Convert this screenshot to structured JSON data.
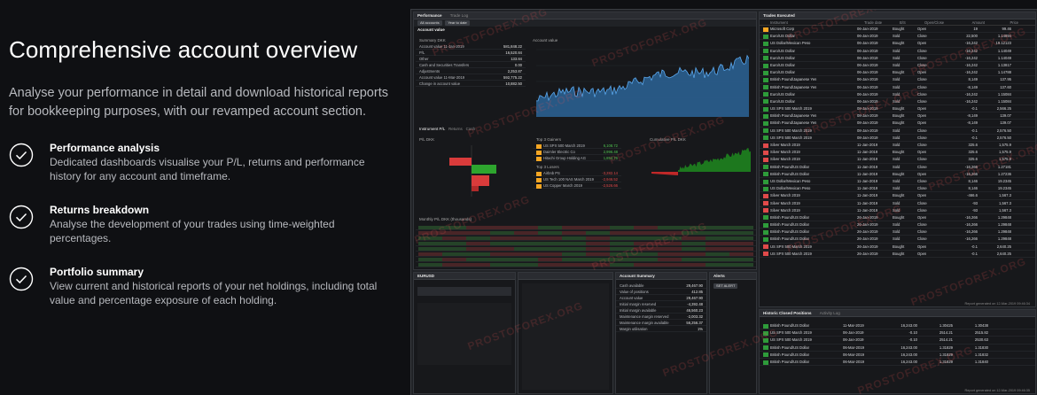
{
  "hero": {
    "headline": "Comprehensive account overview",
    "intro": "Analyse your performance in detail and download historical reports for bookkeeping purposes, with our revamped account section."
  },
  "features": [
    {
      "title": "Performance analysis",
      "desc": "Dedicated dashboards visualise your P/L, returns and performance history for any account and timeframe."
    },
    {
      "title": "Returns breakdown",
      "desc": "Analyse the development of your trades using time-weighted percentages."
    },
    {
      "title": "Portfolio summary",
      "desc": "View current and historical reports of your net holdings, including total value and percentage exposure of each holding."
    }
  ],
  "watermark": "PROSTOFOREX.ORG",
  "colors": {
    "background": "#0f1013",
    "positive": "#4fc24f",
    "negative": "#e04a4a",
    "chart_blue": "#3d8fd6",
    "accent_orange": "#f5a623"
  },
  "screenshot": {
    "performance": {
      "tabs": [
        "Performance",
        "Trade Log"
      ],
      "filter_account": "All accounts",
      "filter_period": "Year to date",
      "section_title": "Account value",
      "summary_title": "Summary DKK",
      "chart_title": "Account value",
      "summary_rows": [
        {
          "label": "Account value 11-Jan-2019",
          "value": "581,848.22"
        },
        {
          "label": "P/L",
          "value": "16,520.84"
        },
        {
          "label": "Other",
          "value": "133.84"
        },
        {
          "label": "Cash and Securities Transfers",
          "value": "0.00"
        },
        {
          "label": "Adjustments",
          "value": "2,253.87"
        },
        {
          "label": "Account value 11-Mar-2019",
          "value": "592,775.22"
        },
        {
          "label": "Change in account value",
          "value": "10,882.50"
        }
      ],
      "instrument_tabs": [
        "Instrument P/L",
        "Returns",
        "Cash"
      ],
      "top_gainers_title": "Top 3 Gainers",
      "top_gainers": [
        {
          "name": "US SPX 500 March 2019",
          "value": "6,108.72"
        },
        {
          "name": "Daimler Electric Co",
          "value": "2,996.48"
        },
        {
          "name": "Hitachi Group Holding AG",
          "value": "1,854.76"
        }
      ],
      "top_losers_title": "Top 3 Losers",
      "top_losers": [
        {
          "name": "Airbnb PS",
          "value": "-3,282.14"
        },
        {
          "name": "US Tech 100 NAS March 2019",
          "value": "-2,946.52"
        },
        {
          "name": "US Copper March 2019",
          "value": "-2,526.66"
        }
      ],
      "cum_title": "Cumulative P/L DKK",
      "monthly_title": "Monthly P/L DKK (thousands)",
      "pl_title": "P/L DKK"
    },
    "trades": {
      "title": "Trades Executed",
      "columns": [
        "Instrument",
        "Trade date",
        "B/S",
        "Open/Close",
        "Amount",
        "Price"
      ],
      "rows": [
        {
          "badge": "orange",
          "name": "Microsoft Corp",
          "date": "06-Jan-2019",
          "bs": "Bought",
          "oc": "Open",
          "amount": "19",
          "price": "99.46"
        },
        {
          "badge": "green",
          "name": "Euro/US Dollar",
          "date": "06-Jan-2019",
          "bs": "Sold",
          "oc": "Close",
          "amount": "22,500",
          "price": "1.14894"
        },
        {
          "badge": "green",
          "name": "US Dollar/Mexican Peso",
          "date": "06-Jan-2019",
          "bs": "Bought",
          "oc": "Open",
          "amount": "-16,242",
          "price": "19.12123"
        },
        {
          "badge": "green",
          "name": "Euro/US Dollar",
          "date": "06-Jan-2019",
          "bs": "Sold",
          "oc": "Close",
          "amount": "-16,242",
          "price": "1.14049"
        },
        {
          "badge": "green",
          "name": "Euro/US Dollar",
          "date": "06-Jan-2019",
          "bs": "Sold",
          "oc": "Close",
          "amount": "-16,242",
          "price": "1.14049"
        },
        {
          "badge": "green",
          "name": "Euro/US Dollar",
          "date": "06-Jan-2019",
          "bs": "Sold",
          "oc": "Close",
          "amount": "-16,242",
          "price": "1.13817"
        },
        {
          "badge": "green",
          "name": "Euro/US Dollar",
          "date": "06-Jan-2019",
          "bs": "Bought",
          "oc": "Open",
          "amount": "-16,242",
          "price": "1.14788"
        },
        {
          "badge": "green",
          "name": "British Pound/Japanese Yen",
          "date": "06-Jan-2019",
          "bs": "Sold",
          "oc": "Close",
          "amount": "8,149",
          "price": "137.95"
        },
        {
          "badge": "green",
          "name": "British Pound/Japanese Yen",
          "date": "06-Jan-2019",
          "bs": "Sold",
          "oc": "Close",
          "amount": "-8,149",
          "price": "137.60"
        },
        {
          "badge": "green",
          "name": "Euro/US Dollar",
          "date": "06-Jan-2019",
          "bs": "Sold",
          "oc": "Close",
          "amount": "-16,242",
          "price": "1.15084"
        },
        {
          "badge": "green",
          "name": "Euro/US Dollar",
          "date": "06-Jan-2019",
          "bs": "Sold",
          "oc": "Close",
          "amount": "-16,242",
          "price": "1.15084"
        },
        {
          "badge": "green",
          "name": "US SPX 500 March 2019",
          "date": "08-Jan-2019",
          "bs": "Bought",
          "oc": "Open",
          "amount": "-0.1",
          "price": "2,566.25"
        },
        {
          "badge": "green",
          "name": "British Pound/Japanese Yen",
          "date": "08-Jan-2019",
          "bs": "Bought",
          "oc": "Open",
          "amount": "-8,149",
          "price": "139.07"
        },
        {
          "badge": "green",
          "name": "British Pound/Japanese Yen",
          "date": "08-Jan-2019",
          "bs": "Bought",
          "oc": "Open",
          "amount": "-8,149",
          "price": "139.07"
        },
        {
          "badge": "green",
          "name": "US SPX 500 March 2019",
          "date": "08-Jan-2019",
          "bs": "Sold",
          "oc": "Close",
          "amount": "-0.1",
          "price": "2,576.50"
        },
        {
          "badge": "green",
          "name": "US SPX 500 March 2019",
          "date": "08-Jan-2019",
          "bs": "Sold",
          "oc": "Close",
          "amount": "-0.1",
          "price": "2,576.50"
        },
        {
          "badge": "red",
          "name": "Silver March 2019",
          "date": "11-Jan-2019",
          "bs": "Sold",
          "oc": "Close",
          "amount": "325.6",
          "price": "1,575.9"
        },
        {
          "badge": "red",
          "name": "Silver March 2019",
          "date": "11-Jan-2019",
          "bs": "Bought",
          "oc": "Open",
          "amount": "325.6",
          "price": "1,575.9"
        },
        {
          "badge": "red",
          "name": "Silver March 2019",
          "date": "11-Jan-2019",
          "bs": "Sold",
          "oc": "Close",
          "amount": "325.6",
          "price": "1,575.9"
        },
        {
          "badge": "green",
          "name": "British Pound/US Dollar",
          "date": "11-Jan-2019",
          "bs": "Sold",
          "oc": "Close",
          "amount": "-16,266",
          "price": "1.27181"
        },
        {
          "badge": "green",
          "name": "British Pound/US Dollar",
          "date": "11-Jan-2019",
          "bs": "Bought",
          "oc": "Open",
          "amount": "-16,266",
          "price": "1.27236"
        },
        {
          "badge": "green",
          "name": "US Dollar/Mexican Peso",
          "date": "11-Jan-2019",
          "bs": "Sold",
          "oc": "Close",
          "amount": "8,146",
          "price": "19.2345"
        },
        {
          "badge": "green",
          "name": "US Dollar/Mexican Peso",
          "date": "11-Jan-2019",
          "bs": "Sold",
          "oc": "Close",
          "amount": "8,146",
          "price": "19.2345"
        },
        {
          "badge": "red",
          "name": "Silver March 2019",
          "date": "11-Jan-2019",
          "bs": "Bought",
          "oc": "Open",
          "amount": "-466.6",
          "price": "1,567.3"
        },
        {
          "badge": "red",
          "name": "Silver March 2019",
          "date": "11-Jan-2019",
          "bs": "Sold",
          "oc": "Close",
          "amount": "-93",
          "price": "1,567.3"
        },
        {
          "badge": "red",
          "name": "Silver March 2019",
          "date": "11-Jan-2019",
          "bs": "Sold",
          "oc": "Close",
          "amount": "-93",
          "price": "1,567.3"
        },
        {
          "badge": "green",
          "name": "British Pound/US Dollar",
          "date": "26-Jan-2019",
          "bs": "Bought",
          "oc": "Open",
          "amount": "-16,266",
          "price": "1.29848"
        },
        {
          "badge": "green",
          "name": "British Pound/US Dollar",
          "date": "26-Jan-2019",
          "bs": "Sold",
          "oc": "Close",
          "amount": "-16,266",
          "price": "1.29848"
        },
        {
          "badge": "green",
          "name": "British Pound/US Dollar",
          "date": "26-Jan-2019",
          "bs": "Sold",
          "oc": "Close",
          "amount": "-16,266",
          "price": "1.29848"
        },
        {
          "badge": "green",
          "name": "British Pound/US Dollar",
          "date": "26-Jan-2019",
          "bs": "Sold",
          "oc": "Close",
          "amount": "-16,266",
          "price": "1.29848"
        },
        {
          "badge": "red",
          "name": "US SPX 500 March 2019",
          "date": "26-Jan-2019",
          "bs": "Bought",
          "oc": "Open",
          "amount": "-0.1",
          "price": "2,640.25"
        },
        {
          "badge": "red",
          "name": "US SPX 500 March 2019",
          "date": "26-Jan-2019",
          "bs": "Bought",
          "oc": "Open",
          "amount": "-0.1",
          "price": "2,640.25"
        }
      ],
      "footer": "Report generated on 12-Mar-2019 09:46:34"
    },
    "closed": {
      "title": "Historic Closed Positions",
      "tab": "Activity Log",
      "rows": [
        {
          "badge": "green",
          "name": "British Pound/US Dollar",
          "date": "11-Mar-2019",
          "a": "16,243.00",
          "b": "1.30425",
          "c": "1.30438"
        },
        {
          "badge": "green",
          "name": "US SPX 500 March 2019",
          "date": "06-Jan-2019",
          "a": "-0.10",
          "b": "2514.21",
          "c": "2515.82"
        },
        {
          "badge": "green",
          "name": "US SPX 500 March 2019",
          "date": "06-Jan-2019",
          "a": "-0.10",
          "b": "2514.21",
          "c": "2530.63"
        },
        {
          "badge": "green",
          "name": "British Pound/US Dollar",
          "date": "06-Mar-2019",
          "a": "16,243.00",
          "b": "1.31829",
          "c": "1.31830"
        },
        {
          "badge": "green",
          "name": "British Pound/US Dollar",
          "date": "06-Mar-2019",
          "a": "16,243.00",
          "b": "1.31829",
          "c": "1.31832"
        },
        {
          "badge": "green",
          "name": "British Pound/US Dollar",
          "date": "06-Mar-2019",
          "a": "16,243.00",
          "b": "1.31829",
          "c": "1.31840"
        }
      ],
      "footer": "Report generated on 12-Mar-2019 09:46:35"
    },
    "bottom": {
      "trade_title": "EURUSD",
      "account_title": "Account Summary",
      "account_rows": [
        {
          "label": "Cash available",
          "value": "29,467.90"
        },
        {
          "label": "Value of positions",
          "value": "412.85"
        },
        {
          "label": "Account value",
          "value": "29,467.90"
        },
        {
          "label": "Initial margin reserved",
          "value": "-4,392.48"
        },
        {
          "label": "Initial margin available",
          "value": "46,560.23"
        },
        {
          "label": "Maintenance margin reserved",
          "value": "-2,003.32"
        },
        {
          "label": "Maintenance margin available",
          "value": "56,256.37"
        },
        {
          "label": "Margin utilisation",
          "value": "1%"
        }
      ],
      "alerts_title": "Alerts",
      "alerts_btn": "SET ALERT"
    }
  }
}
